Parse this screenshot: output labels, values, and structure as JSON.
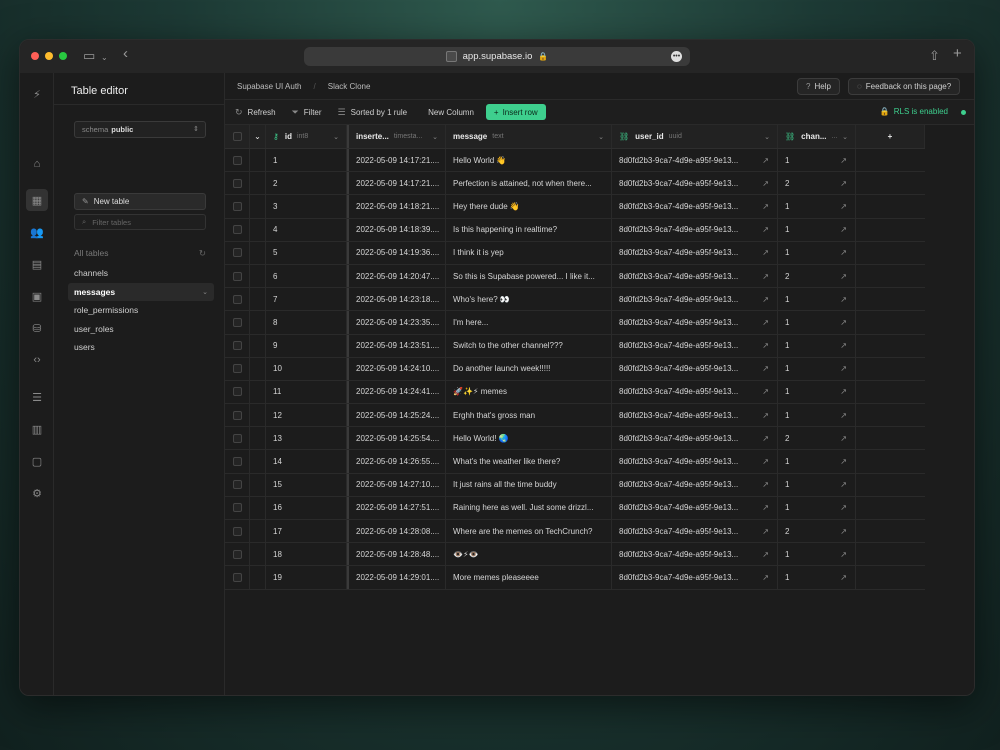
{
  "browser": {
    "url": "app.supabase.io",
    "lock": "🔒"
  },
  "panel": {
    "title": "Table editor",
    "schema_label": "schema",
    "schema_value": "public",
    "new_table": "New table",
    "filter_placeholder": "Filter tables",
    "all_tables": "All tables",
    "tables": [
      "channels",
      "messages",
      "role_permissions",
      "user_roles",
      "users"
    ],
    "active_table": "messages"
  },
  "breadcrumbs": [
    "Supabase UI Auth",
    "Slack Clone"
  ],
  "header": {
    "help": "Help",
    "feedback": "Feedback on this page?"
  },
  "toolbar": {
    "refresh": "Refresh",
    "filter": "Filter",
    "sort": "Sorted by 1 rule",
    "new_column": "New Column",
    "insert_row": "Insert row",
    "rls": "RLS is enabled"
  },
  "columns": [
    {
      "name": "id",
      "type": "int8"
    },
    {
      "name": "inserte...",
      "type": "timesta..."
    },
    {
      "name": "message",
      "type": "text"
    },
    {
      "name": "user_id",
      "type": "uuid"
    },
    {
      "name": "chan...",
      "type": "..."
    }
  ],
  "rows": [
    {
      "id": "1",
      "inserted": "2022-05-09 14:17:21....",
      "message": "Hello World 👋",
      "user_id": "8d0fd2b3-9ca7-4d9e-a95f-9e13...",
      "channel": "1"
    },
    {
      "id": "2",
      "inserted": "2022-05-09 14:17:21....",
      "message": "Perfection is attained, not when there...",
      "user_id": "8d0fd2b3-9ca7-4d9e-a95f-9e13...",
      "channel": "2"
    },
    {
      "id": "3",
      "inserted": "2022-05-09 14:18:21....",
      "message": "Hey there dude 👋",
      "user_id": "8d0fd2b3-9ca7-4d9e-a95f-9e13...",
      "channel": "1"
    },
    {
      "id": "4",
      "inserted": "2022-05-09 14:18:39....",
      "message": "Is this happening in realtime?",
      "user_id": "8d0fd2b3-9ca7-4d9e-a95f-9e13...",
      "channel": "1"
    },
    {
      "id": "5",
      "inserted": "2022-05-09 14:19:36....",
      "message": "I think it is yep",
      "user_id": "8d0fd2b3-9ca7-4d9e-a95f-9e13...",
      "channel": "1"
    },
    {
      "id": "6",
      "inserted": "2022-05-09 14:20:47....",
      "message": "So this is Supabase powered... I like it...",
      "user_id": "8d0fd2b3-9ca7-4d9e-a95f-9e13...",
      "channel": "2"
    },
    {
      "id": "7",
      "inserted": "2022-05-09 14:23:18....",
      "message": "Who's here? 👀",
      "user_id": "8d0fd2b3-9ca7-4d9e-a95f-9e13...",
      "channel": "1"
    },
    {
      "id": "8",
      "inserted": "2022-05-09 14:23:35....",
      "message": "I'm here...",
      "user_id": "8d0fd2b3-9ca7-4d9e-a95f-9e13...",
      "channel": "1"
    },
    {
      "id": "9",
      "inserted": "2022-05-09 14:23:51....",
      "message": "Switch to the other channel???",
      "user_id": "8d0fd2b3-9ca7-4d9e-a95f-9e13...",
      "channel": "1"
    },
    {
      "id": "10",
      "inserted": "2022-05-09 14:24:10....",
      "message": "Do another launch week!!!!!",
      "user_id": "8d0fd2b3-9ca7-4d9e-a95f-9e13...",
      "channel": "1"
    },
    {
      "id": "11",
      "inserted": "2022-05-09 14:24:41....",
      "message": "🚀✨⚡ memes",
      "user_id": "8d0fd2b3-9ca7-4d9e-a95f-9e13...",
      "channel": "1"
    },
    {
      "id": "12",
      "inserted": "2022-05-09 14:25:24....",
      "message": "Erghh that's gross man",
      "user_id": "8d0fd2b3-9ca7-4d9e-a95f-9e13...",
      "channel": "1"
    },
    {
      "id": "13",
      "inserted": "2022-05-09 14:25:54....",
      "message": "Hello World! 🌏",
      "user_id": "8d0fd2b3-9ca7-4d9e-a95f-9e13...",
      "channel": "2"
    },
    {
      "id": "14",
      "inserted": "2022-05-09 14:26:55....",
      "message": "What's the weather like there?",
      "user_id": "8d0fd2b3-9ca7-4d9e-a95f-9e13...",
      "channel": "1"
    },
    {
      "id": "15",
      "inserted": "2022-05-09 14:27:10....",
      "message": "It just rains all the time buddy",
      "user_id": "8d0fd2b3-9ca7-4d9e-a95f-9e13...",
      "channel": "1"
    },
    {
      "id": "16",
      "inserted": "2022-05-09 14:27:51....",
      "message": "Raining here as well. Just some drizzl...",
      "user_id": "8d0fd2b3-9ca7-4d9e-a95f-9e13...",
      "channel": "1"
    },
    {
      "id": "17",
      "inserted": "2022-05-09 14:28:08....",
      "message": "Where are the memes on TechCrunch?",
      "user_id": "8d0fd2b3-9ca7-4d9e-a95f-9e13...",
      "channel": "2"
    },
    {
      "id": "18",
      "inserted": "2022-05-09 14:28:48....",
      "message": "👁️⚡👁️",
      "user_id": "8d0fd2b3-9ca7-4d9e-a95f-9e13...",
      "channel": "1"
    },
    {
      "id": "19",
      "inserted": "2022-05-09 14:29:01....",
      "message": "More memes pleaseeee",
      "user_id": "8d0fd2b3-9ca7-4d9e-a95f-9e13...",
      "channel": "1"
    }
  ],
  "icons": {
    "logo": "supabase-bolt",
    "add_column": "+"
  },
  "colors": {
    "brand": "#3ecf8e",
    "background": "#1c1c1c"
  }
}
